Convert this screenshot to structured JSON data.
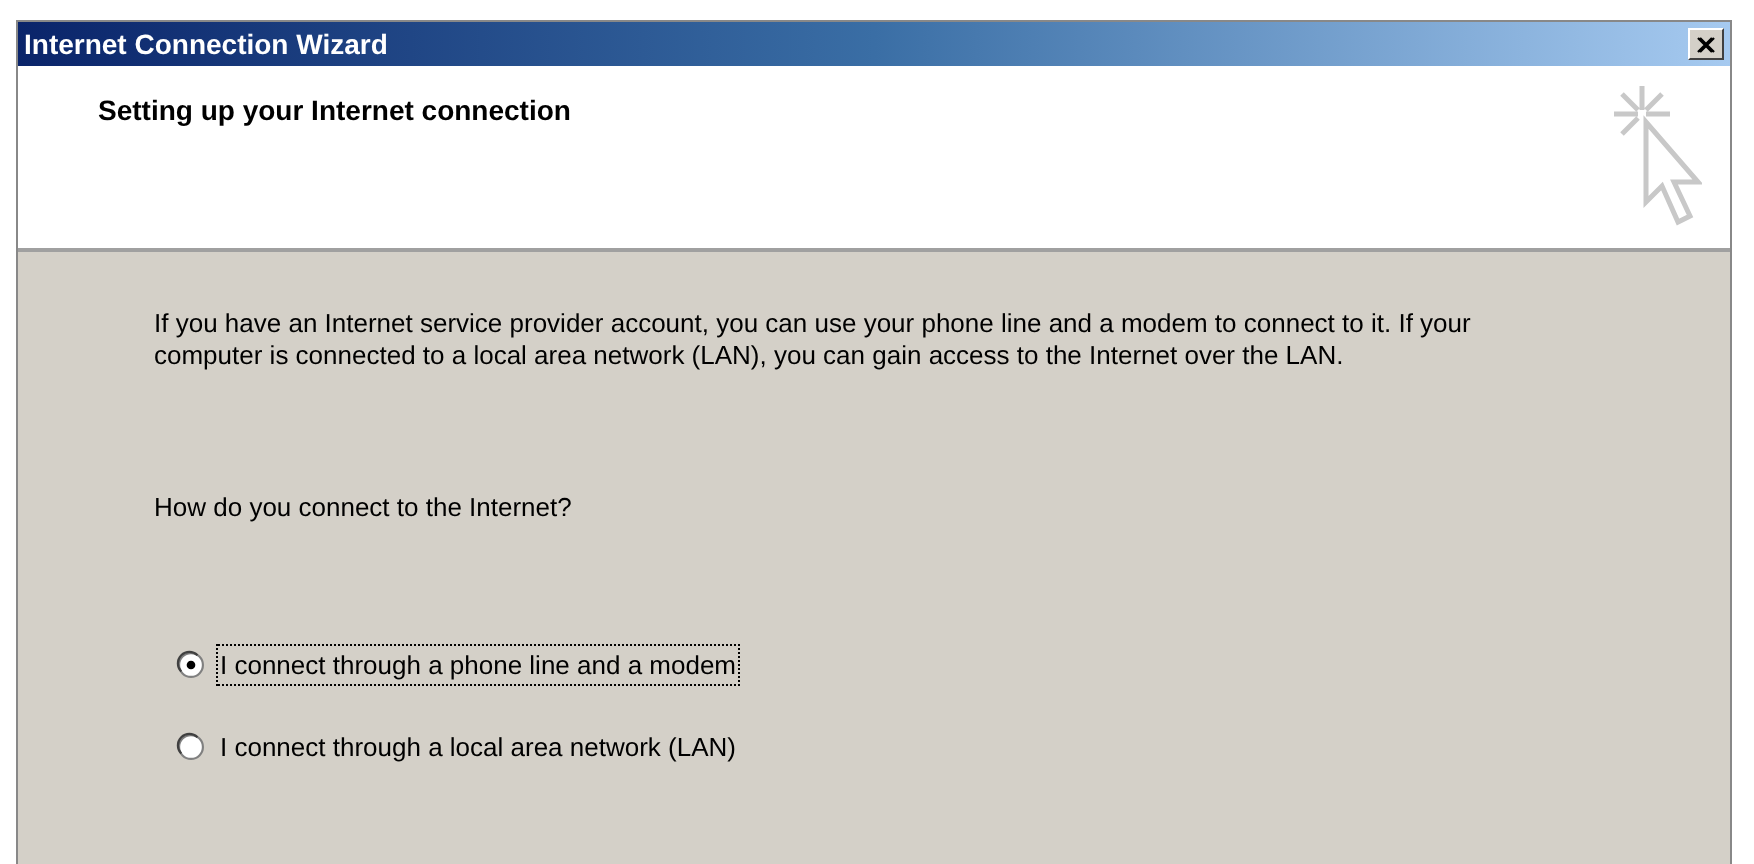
{
  "window": {
    "title": "Internet Connection Wizard"
  },
  "header": {
    "title": "Setting up your Internet connection"
  },
  "intro": "If you have an Internet service provider account, you can use your phone line and a modem to connect to it. If your computer is connected to a local area network (LAN), you can gain access to the Internet over the LAN.",
  "question": "How do you connect to the Internet?",
  "options": [
    {
      "label": "I connect through a phone line and a modem",
      "selected": true,
      "focused": true
    },
    {
      "label": "I connect through a local area network (LAN)",
      "selected": false,
      "focused": false
    }
  ]
}
